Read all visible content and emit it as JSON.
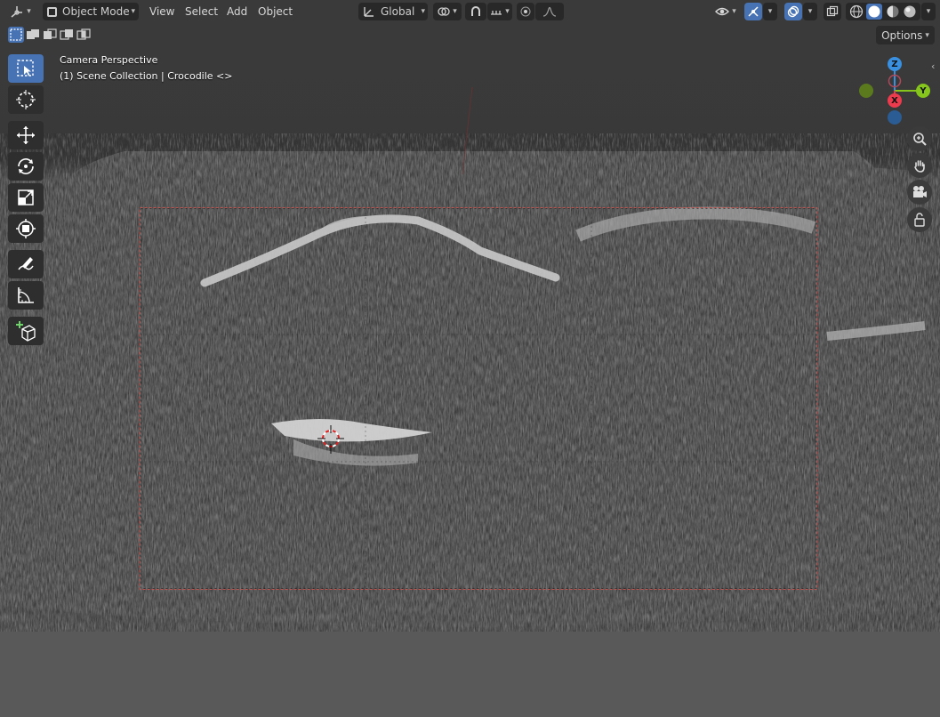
{
  "header": {
    "editor_type_icon": "3d-viewport-icon",
    "mode": {
      "label": "Object Mode",
      "icon": "object-mode-icon"
    },
    "menus": [
      "View",
      "Select",
      "Add",
      "Object"
    ],
    "transform_orientation": "Global",
    "icons": [
      "pivot-icon",
      "snap-icon",
      "proportional-edit-icon",
      "falloff-icon",
      "visibility-icon",
      "gizmo-icon",
      "overlay-icon",
      "xray-icon",
      "wireframe-shading-icon",
      "solid-shading-icon",
      "material-shading-icon",
      "rendered-shading-icon"
    ]
  },
  "select_modes": [
    "select-new-icon",
    "select-extend-icon",
    "select-subtract-icon",
    "select-invert-icon",
    "select-intersect-icon"
  ],
  "options_label": "Options",
  "toolbar": {
    "tools": [
      "select-box",
      "cursor",
      "move",
      "rotate",
      "scale",
      "transform",
      "annotate",
      "measure",
      "add-cube"
    ],
    "active": "select-box"
  },
  "overlay": {
    "view_name": "Camera Perspective",
    "collection_info": "(1) Scene Collection | Crocodile <>"
  },
  "gizmo": {
    "axis_labels": {
      "x": "X",
      "y": "Y",
      "z": "Z"
    },
    "colors": {
      "x": "#ed3b4e",
      "y": "#85c51c",
      "z": "#3a90e0",
      "neg_y": "#5b7a1e",
      "neg_z": "#2b5c93"
    }
  },
  "nav_buttons": [
    "zoom-icon",
    "pan-hand-icon",
    "camera-view-icon",
    "lock-camera-icon"
  ],
  "colors": {
    "accent": "#4772b3",
    "header_button": "#282828",
    "camera_frame": "#c8504a"
  }
}
